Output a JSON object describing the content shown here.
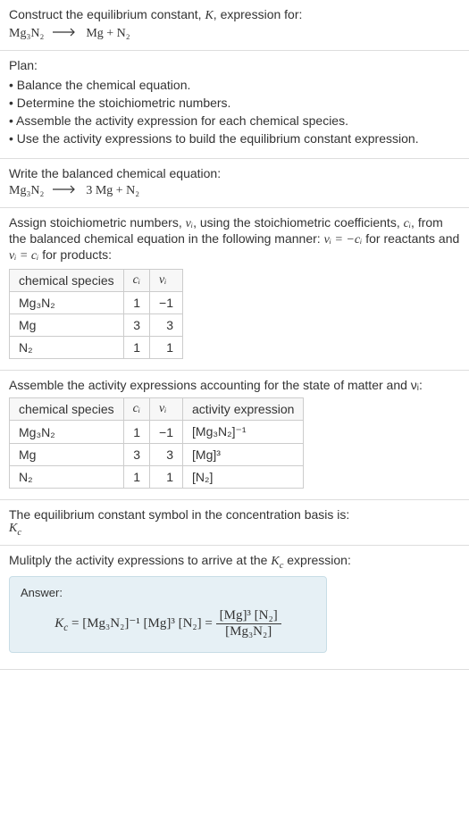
{
  "header": {
    "title_line1": "Construct the equilibrium constant, ",
    "K": "K",
    "title_line2": ", expression for:"
  },
  "unbalanced_eq": {
    "lhs": "Mg₃N₂",
    "rhs": "Mg + N₂"
  },
  "plan": {
    "heading": "Plan:",
    "items": [
      "Balance the chemical equation.",
      "Determine the stoichiometric numbers.",
      "Assemble the activity expression for each chemical species.",
      "Use the activity expressions to build the equilibrium constant expression."
    ]
  },
  "balanced": {
    "heading": "Write the balanced chemical equation:",
    "lhs": "Mg₃N₂",
    "rhs": "3 Mg + N₂"
  },
  "stoich": {
    "intro1": "Assign stoichiometric numbers, ",
    "nu_i": "νᵢ",
    "intro2": ", using the stoichiometric coefficients, ",
    "c_i": "cᵢ",
    "intro3": ", from the balanced chemical equation in the following manner: ",
    "rule_react": "νᵢ = −cᵢ",
    "intro4": " for reactants and ",
    "rule_prod": "νᵢ = cᵢ",
    "intro5": " for products:",
    "table": {
      "h1": "chemical species",
      "h2": "cᵢ",
      "h3": "νᵢ",
      "rows": [
        {
          "species": "Mg₃N₂",
          "c": "1",
          "v": "−1"
        },
        {
          "species": "Mg",
          "c": "3",
          "v": "3"
        },
        {
          "species": "N₂",
          "c": "1",
          "v": "1"
        }
      ]
    }
  },
  "activity": {
    "intro": "Assemble the activity expressions accounting for the state of matter and νᵢ:",
    "table": {
      "h1": "chemical species",
      "h2": "cᵢ",
      "h3": "νᵢ",
      "h4": "activity expression",
      "rows": [
        {
          "species": "Mg₃N₂",
          "c": "1",
          "v": "−1",
          "act": "[Mg₃N₂]⁻¹"
        },
        {
          "species": "Mg",
          "c": "3",
          "v": "3",
          "act": "[Mg]³"
        },
        {
          "species": "N₂",
          "c": "1",
          "v": "1",
          "act": "[N₂]"
        }
      ]
    }
  },
  "symbol": {
    "line1": "The equilibrium constant symbol in the concentration basis is:",
    "Kc": "K𞁞"
  },
  "multiply": {
    "line": "Mulitply the activity expressions to arrive at the ",
    "Kc": "K𞁞",
    "line2": " expression:"
  },
  "answer": {
    "label": "Answer:",
    "Kc": "K𞁞",
    "eq": " = [Mg₃N₂]⁻¹ [Mg]³ [N₂] = ",
    "frac_top": "[Mg]³ [N₂]",
    "frac_bot": "[Mg₃N₂]"
  }
}
